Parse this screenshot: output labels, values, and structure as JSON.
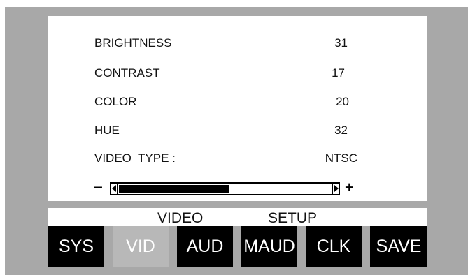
{
  "settings": [
    {
      "label": "BRIGHTNESS",
      "value": "31"
    },
    {
      "label": "CONTRAST",
      "value": "17"
    },
    {
      "label": "COLOR",
      "value": "20"
    },
    {
      "label": "HUE",
      "value": "32"
    },
    {
      "label": "VIDEO  TYPE :",
      "value": "NTSC"
    }
  ],
  "slider": {
    "minus": "−",
    "plus": "+",
    "level": 0.52
  },
  "title": {
    "left": "VIDEO",
    "right": "SETUP"
  },
  "tabs": [
    {
      "label": "SYS",
      "active": false
    },
    {
      "label": "VID",
      "active": true
    },
    {
      "label": "AUD",
      "active": false
    },
    {
      "label": "MAUD",
      "active": false
    },
    {
      "label": "CLK",
      "active": false
    },
    {
      "label": "SAVE",
      "active": false
    }
  ],
  "colors": {
    "frame": "#a8a8a8",
    "tab_bg": "#000000",
    "tab_active_bg": "#b8b8b8"
  }
}
